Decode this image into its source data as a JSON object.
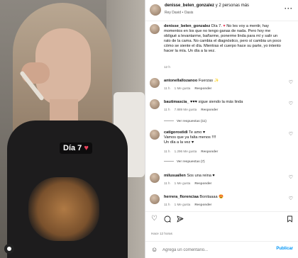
{
  "photo": {
    "caption_text": "Día 7",
    "caption_emoji": "♥"
  },
  "header": {
    "username": "denisse_belen_gonzalez",
    "others": "y 2 personas más",
    "subtitle": "Rey David • Oasis"
  },
  "post": {
    "username": "denisse_belen_gonzalez",
    "caption": "No les voy a mentir, hay momentos en los que no tengo ganas de nada. Pero hoy me obligué a levantarme, bañarme, ponerme linda para mí y salir un rato de la cama. No cambia el diagnóstico, pero sí cambia un poco cómo se siente el día. Mientras el cuerpo hace su parte, yo intento hacer la mía. Un día a la vez.",
    "title_prefix": "Día 7.",
    "time": "12 h"
  },
  "comments": [
    {
      "user": "antonellallozanoo",
      "text": "Fuerzas ✨",
      "time": "11 h",
      "likes": "1 Me gusta",
      "reply": "Responder"
    },
    {
      "user": "bautimascia_",
      "text": "♥♥♥ sigue siendo la más linda",
      "time": "11 h",
      "likes": "7.889 Me gusta",
      "reply": "Responder",
      "view_replies": "Ver respuestas (11)"
    },
    {
      "user": "catigorostidi",
      "text": "Te amo ♥\nVamos que ya falta menos !!!!\nUn día a la vez ♥",
      "time": "11 h",
      "likes": "1.296 Me gusta",
      "reply": "Responder",
      "view_replies": "Ver respuestas (7)"
    },
    {
      "user": "milusuallen",
      "text": "Sos una reina ♥",
      "time": "11 h",
      "likes": "1 Me gusta",
      "reply": "Responder"
    },
    {
      "user": "herrera_florenciaa",
      "text": "Bonitaaaa 😍",
      "time": "11 h",
      "likes": "1 Me gusta",
      "reply": "Responder"
    }
  ],
  "actions": {
    "like_icon": "heart-outline-icon",
    "comment_icon": "comment-icon",
    "share_icon": "send-icon",
    "save_icon": "bookmark-icon"
  },
  "timestamp": "Hace 12 horas",
  "comment_bar": {
    "placeholder": "Agrega un comentario...",
    "publish_label": "Publicar"
  },
  "colors": {
    "accent": "#0095f6",
    "heart": "#e8425c"
  }
}
